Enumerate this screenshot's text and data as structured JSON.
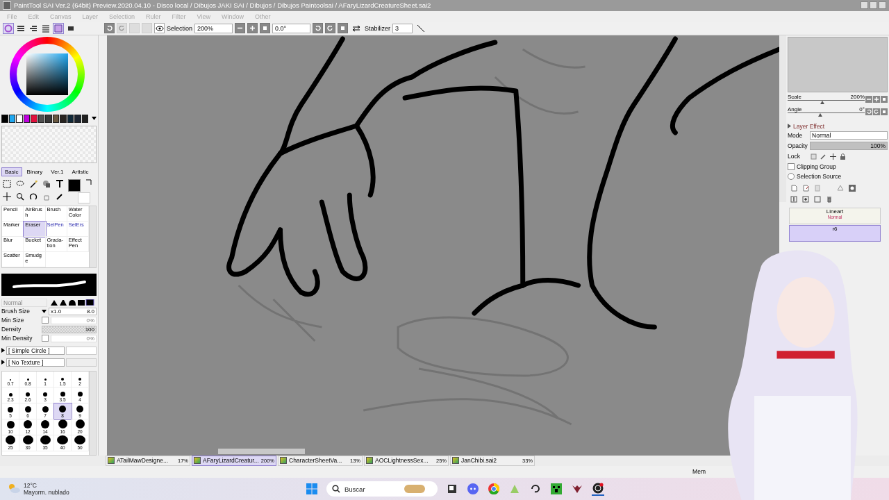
{
  "window": {
    "title": "PaintTool SAI Ver.2 (64bit) Preview.2020.04.10 - Disco local / Dibujos JAKI SAI / Dibujos / Dibujos Paintoolsai / AFaryLizardCreatureSheet.sai2"
  },
  "menu": [
    "File",
    "Edit",
    "Canvas",
    "Layer",
    "Selection",
    "Ruler",
    "Filter",
    "View",
    "Window",
    "Other"
  ],
  "toolbar": {
    "selection_label": "Selection",
    "zoom": "200%",
    "angle": "0.0°",
    "stabilizer_label": "Stabilizer",
    "stabilizer": "3"
  },
  "swatches": [
    {
      "color": "#000000"
    },
    {
      "color": "#1ea7f0"
    },
    {
      "color": "#ffffff"
    },
    {
      "color": "#c000e0"
    },
    {
      "color": "#e0103c"
    },
    {
      "color": "#505050"
    },
    {
      "color": "#383838"
    },
    {
      "color": "#6a5840"
    },
    {
      "color": "#282420"
    },
    {
      "color": "#102838"
    },
    {
      "color": "#1c2430"
    },
    {
      "color": "#202020"
    }
  ],
  "tool_tabs": [
    {
      "label": "Basic",
      "selected": true
    },
    {
      "label": "Binary",
      "selected": false
    },
    {
      "label": "Ver.1",
      "selected": false
    },
    {
      "label": "Artistic",
      "selected": false
    }
  ],
  "tools": [
    {
      "label": "Pencil",
      "kind": "paint",
      "selected": false
    },
    {
      "label": "AirBrush",
      "kind": "paint",
      "selected": false
    },
    {
      "label": "Brush",
      "kind": "paint",
      "selected": false
    },
    {
      "label": "Water Color",
      "kind": "paint",
      "selected": false
    },
    {
      "label": "Marker",
      "kind": "paint",
      "selected": false
    },
    {
      "label": "Eraser",
      "kind": "paint",
      "selected": true
    },
    {
      "label": "SelPen",
      "kind": "selection",
      "selected": false
    },
    {
      "label": "SelErs",
      "kind": "selection",
      "selected": false
    },
    {
      "label": "Blur",
      "kind": "paint",
      "selected": false
    },
    {
      "label": "Bucket",
      "kind": "paint",
      "selected": false
    },
    {
      "label": "Grada-tion",
      "kind": "paint",
      "selected": false
    },
    {
      "label": "Effect Pen",
      "kind": "paint",
      "selected": false
    },
    {
      "label": "Scatter",
      "kind": "paint",
      "selected": false
    },
    {
      "label": "Smudge",
      "kind": "paint",
      "selected": false
    }
  ],
  "brush": {
    "mode": "Normal",
    "size_label": "Brush Size",
    "size_multiplier": "x1.0",
    "size": "8.0",
    "min_size_label": "Min Size",
    "min_size_checked": false,
    "min_size": "0%",
    "density_label": "Density",
    "density": "100",
    "min_density_label": "Min Density",
    "min_density_checked": false,
    "min_density": "0%",
    "shape": "[ Simple Circle ]",
    "texture": "[ No Texture ]"
  },
  "brush_sizes": [
    {
      "label": "0.7",
      "selected": false
    },
    {
      "label": "0.8",
      "selected": false
    },
    {
      "label": "1",
      "selected": false
    },
    {
      "label": "1.5",
      "selected": false
    },
    {
      "label": "2",
      "selected": false
    },
    {
      "label": "2.3",
      "selected": false
    },
    {
      "label": "2.6",
      "selected": false
    },
    {
      "label": "3",
      "selected": false
    },
    {
      "label": "3.5",
      "selected": false
    },
    {
      "label": "4",
      "selected": false
    },
    {
      "label": "5",
      "selected": false
    },
    {
      "label": "6",
      "selected": false
    },
    {
      "label": "7",
      "selected": false
    },
    {
      "label": "8",
      "selected": true
    },
    {
      "label": "9",
      "selected": false
    },
    {
      "label": "10",
      "selected": false
    },
    {
      "label": "12",
      "selected": false
    },
    {
      "label": "14",
      "selected": false
    },
    {
      "label": "16",
      "selected": false
    },
    {
      "label": "20",
      "selected": false
    },
    {
      "label": "25",
      "selected": false
    },
    {
      "label": "30",
      "selected": false
    },
    {
      "label": "35",
      "selected": false
    },
    {
      "label": "40",
      "selected": false
    },
    {
      "label": "50",
      "selected": false
    }
  ],
  "navigator": {
    "scale_label": "Scale",
    "scale": "200%",
    "scale_slider": {
      "level": 0.45
    },
    "angle_label": "Angle",
    "angle": "0°",
    "angle_slider": {
      "level": 0.42
    }
  },
  "layer_panel": {
    "effect_label": "Layer Effect",
    "mode_label": "Mode",
    "mode": "Normal",
    "opacity_label": "Opacity",
    "opacity": "100%",
    "opacity_bar": {
      "level": 1
    },
    "lock_label": "Lock",
    "clipping_group": {
      "label": "Clipping Group",
      "checked": false
    },
    "selection_source": {
      "label": "Selection Source",
      "checked": false
    }
  },
  "layers": [
    {
      "name": "Lineart",
      "mode": "Normal",
      "selected": false
    },
    {
      "name": "r6",
      "selected": true
    }
  ],
  "doc_tabs": [
    {
      "name": "ATailMawDesigne...",
      "zoom": "17%",
      "selected": false
    },
    {
      "name": "AFaryLizardCreatur...",
      "zoom": "200%",
      "selected": true
    },
    {
      "name": "CharacterSheetVa...",
      "zoom": "13%",
      "selected": false
    },
    {
      "name": "AOCLightnessSex...",
      "zoom": "25%",
      "selected": false
    },
    {
      "name": "JanChibi.sai2",
      "zoom": "33%",
      "selected": false
    }
  ],
  "status_bar": {
    "memory_label": "Mem"
  },
  "taskbar": {
    "temperature": "12°C",
    "weather": "Mayorm. nublado",
    "search_placeholder": "Buscar"
  }
}
